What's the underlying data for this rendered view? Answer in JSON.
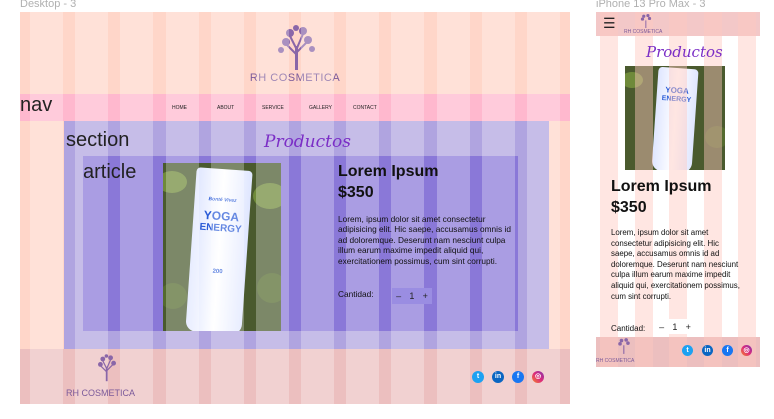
{
  "desktop": {
    "frame_label": "Desktop - 3",
    "brand": "RH COSMETICA",
    "nav_tag": "nav",
    "nav_items": [
      "HOME",
      "ABOUT",
      "SERVICE",
      "GALLERY",
      "CONTACT"
    ],
    "section_tag": "section",
    "section_title": "Productos",
    "article_tag": "article",
    "product_name": "Lorem Ipsum",
    "price": "$350",
    "description": "Lorem, ipsum dolor sit amet consectetur adipisicing elit. Hic saepe, accusamus omnis id ad doloremque. Deserunt nam nesciunt culpa illum earum maxime impedit aliquid qui, exercitationem possimus, cum sint corrupti.",
    "qty_label": "Cantidad:",
    "qty_minus": "–",
    "qty_value": "1",
    "qty_plus": "+",
    "footer_brand": "RH COSMETICA",
    "social_icons": [
      "twitter-icon",
      "linkedin-icon",
      "facebook-icon",
      "instagram-icon"
    ]
  },
  "mobile": {
    "frame_label": "iPhone 13 Pro Max - 3",
    "brand": "RH COSMETICA",
    "menu_icon": "hamburger-icon",
    "section_title": "Productos",
    "product_name": "Lorem Ipsum",
    "price": "$350",
    "description": "Lorem, ipsum dolor sit amet consectetur adipisicing elit. Hic saepe, accusamus omnis id ad doloremque. Deserunt nam nesciunt culpa illum earum maxime impedit aliquid qui, exercitationem possimus, cum sint corrupti.",
    "qty_label": "Cantidad:",
    "qty_minus": "–",
    "qty_value": "1",
    "qty_plus": "+",
    "footer_brand": "RH COSMETICA"
  },
  "product_packaging": {
    "brand_line": "Bonté Vivez",
    "line1": "YOGA",
    "line2": "ENERGY",
    "size": "200"
  },
  "colors": {
    "column_overlay": "#ffd6c9",
    "nav_bar": "#ffb8ce",
    "section": "#b0a4e0",
    "article": "#8a78d8",
    "title_script": "#7b2ec6",
    "footer": "#ecbfbf"
  }
}
